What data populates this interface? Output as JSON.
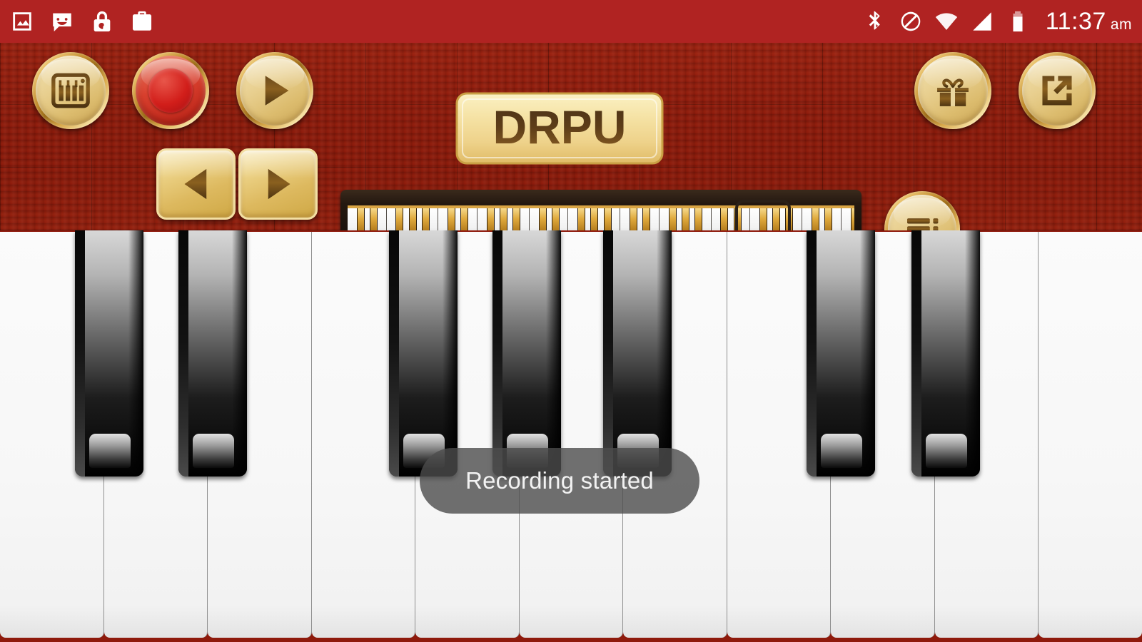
{
  "status_bar": {
    "background_color": "#b02322",
    "left_icons": [
      {
        "name": "image-icon",
        "label": "Screenshot"
      },
      {
        "name": "message-smiley-icon",
        "label": "Messages"
      },
      {
        "name": "lock-icon",
        "label": "Screen lock"
      },
      {
        "name": "work-briefcase-check-icon",
        "label": "Work profile"
      }
    ],
    "right_icons": [
      {
        "name": "bluetooth-icon",
        "label": "Bluetooth"
      },
      {
        "name": "do-not-disturb-icon",
        "label": "Do not disturb"
      },
      {
        "name": "wifi-icon",
        "label": "Wi-Fi"
      },
      {
        "name": "cellular-signal-icon",
        "label": "Cellular signal"
      },
      {
        "name": "battery-icon",
        "label": "Battery"
      }
    ],
    "clock": "11:37",
    "clock_ampm": "am"
  },
  "app": {
    "logo_text": "DRPU",
    "panel_color": "#8e1a0c",
    "gold_color": "#e0b75f"
  },
  "toolbar": {
    "keyboard_button_label": "Instruments",
    "record_button_label": "Record",
    "play_button_label": "Play",
    "gift_button_label": "Gift",
    "share_button_label": "Share"
  },
  "octave_bar": {
    "prev_label": "Previous octave",
    "next_label": "Next octave",
    "menu_label": "Menu",
    "mini_keyboard_label": "Keyboard overview",
    "mini_keyboard_white_keys": 39,
    "mini_viewport_label": "Visible range"
  },
  "piano": {
    "white_key_count": 11,
    "black_key_positions": [
      105,
      250,
      545,
      690,
      845,
      1130,
      1277
    ],
    "black_key_width": 96,
    "black_key_height": 345,
    "white_key_color": "#f8f8f8",
    "black_key_color": "#000000"
  },
  "toast": {
    "message": "Recording started",
    "background_color": "rgba(76,76,76,0.80)",
    "text_color": "#f2f2f2"
  }
}
